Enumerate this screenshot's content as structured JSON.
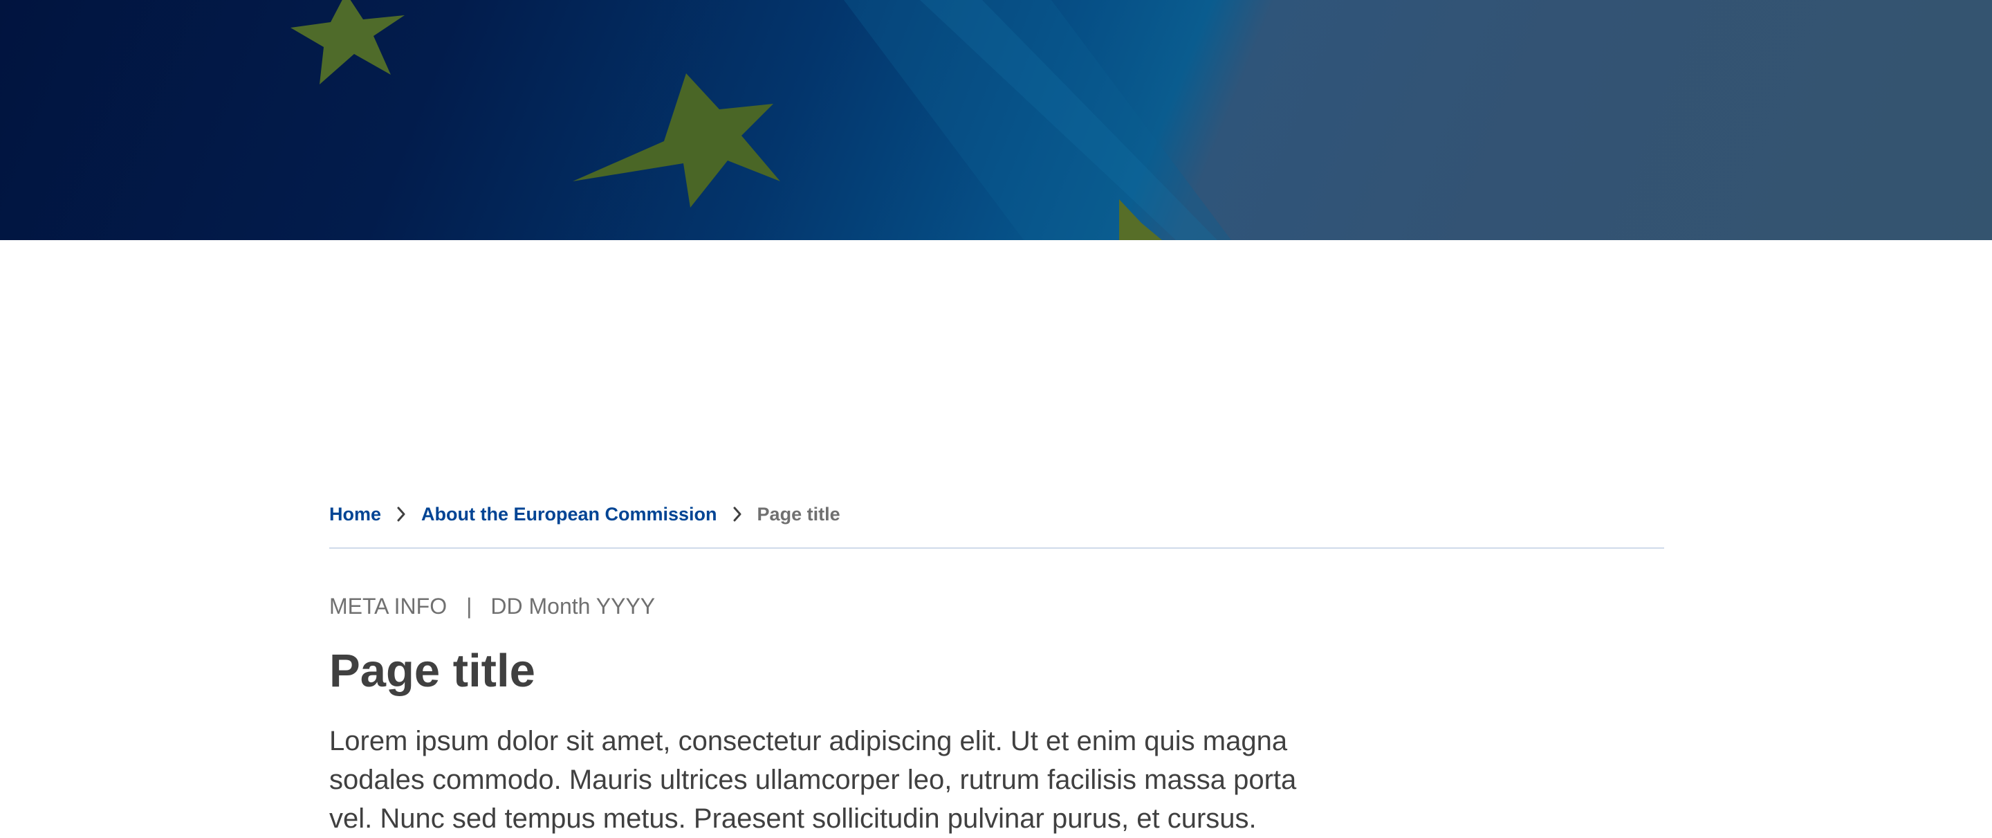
{
  "hero": {
    "image": "eu-flag-banner",
    "colors": {
      "flag_blue": "#021c4c",
      "star_yellow": "#4f6b2a",
      "overlay": "#34546f"
    }
  },
  "breadcrumb": {
    "items": [
      {
        "label": "Home",
        "link": true
      },
      {
        "label": "About the European Commission",
        "link": true
      },
      {
        "label": "Page title",
        "link": false
      }
    ],
    "separator_icon": "chevron-right-icon",
    "link_color": "#004494"
  },
  "meta": {
    "type": "META INFO",
    "separator": "|",
    "date": "DD Month YYYY"
  },
  "page": {
    "title": "Page title",
    "intro": "Lorem ipsum dolor sit amet, consectetur adipiscing elit. Ut et enim quis magna sodales commodo. Mauris ultrices ullamcorper leo, rutrum facilisis massa porta vel. Nunc sed tempus metus. Praesent sollicitudin pulvinar purus, et cursus."
  }
}
